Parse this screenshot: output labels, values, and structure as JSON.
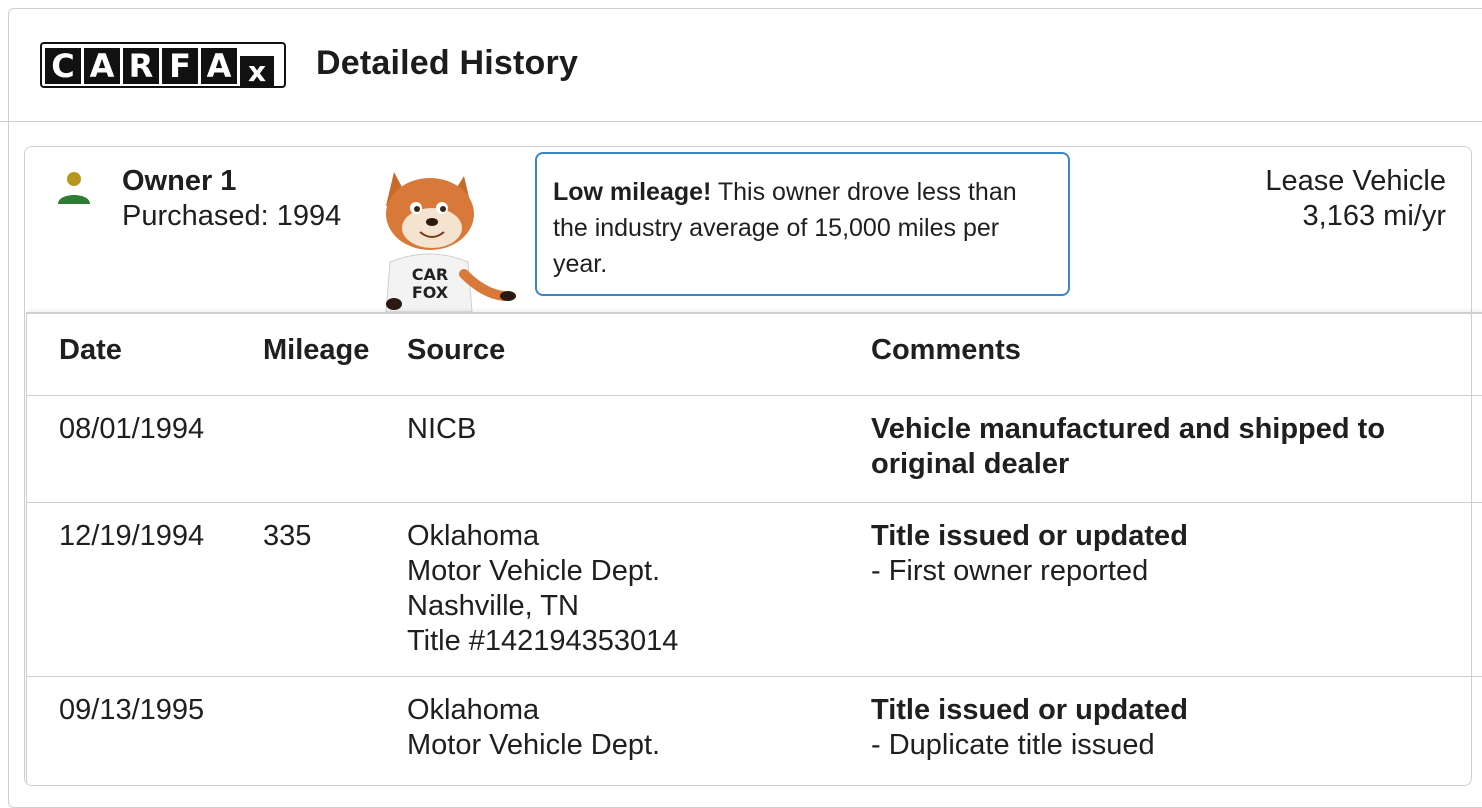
{
  "header": {
    "logo_letters": [
      "C",
      "A",
      "R",
      "F",
      "A",
      "x"
    ],
    "title": "Detailed History"
  },
  "owner": {
    "name": "Owner 1",
    "purchased": "Purchased: 1994",
    "icon": "person-icon",
    "icon_colors": {
      "head": "#b8961e",
      "body": "#2e7d32"
    }
  },
  "tip": {
    "bold": "Low mileage!",
    "text": " This owner drove less than the industry average of 15,000 miles per year.",
    "border_color": "#3a86c8"
  },
  "mascot": {
    "shirt_line1": "CAR",
    "shirt_line2": "FOX"
  },
  "lease": {
    "label": "Lease Vehicle",
    "value": "3,163 mi/yr"
  },
  "table": {
    "headers": {
      "date": "Date",
      "mileage": "Mileage",
      "source": "Source",
      "comments": "Comments"
    },
    "rows": [
      {
        "date": "08/01/1994",
        "mileage": "",
        "source": [
          "NICB"
        ],
        "comment_title": "Vehicle manufactured and shipped to original dealer",
        "comment_detail": ""
      },
      {
        "date": "12/19/1994",
        "mileage": "335",
        "source": [
          "Oklahoma",
          "Motor Vehicle Dept.",
          "Nashville, TN",
          "Title #142194353014"
        ],
        "comment_title": "Title issued or updated",
        "comment_detail": "- First owner reported"
      },
      {
        "date": "09/13/1995",
        "mileage": "",
        "source": [
          "Oklahoma",
          "Motor Vehicle Dept."
        ],
        "comment_title": "Title issued or updated",
        "comment_detail": "- Duplicate title issued"
      }
    ]
  }
}
